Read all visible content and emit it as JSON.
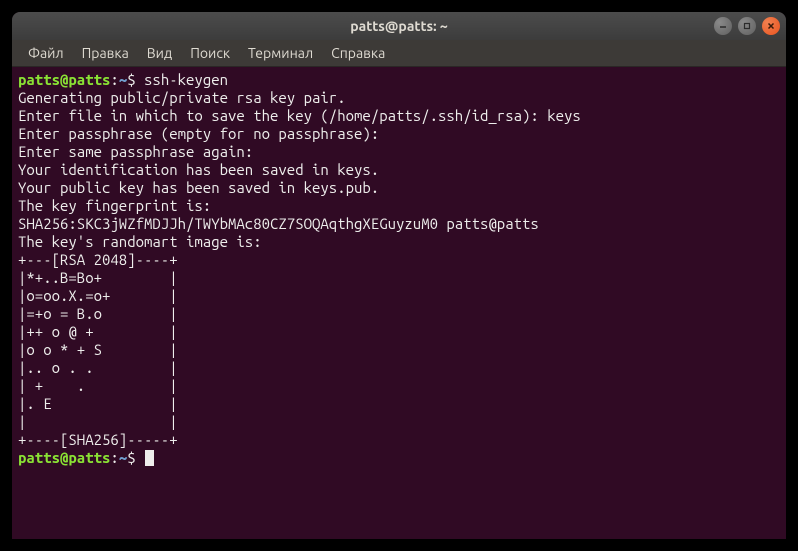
{
  "window": {
    "title": "patts@patts: ~"
  },
  "menu": {
    "items": [
      "Файл",
      "Правка",
      "Вид",
      "Поиск",
      "Терминал",
      "Справка"
    ]
  },
  "prompt": {
    "userhost": "patts@patts",
    "sep": ":",
    "path": "~",
    "symbol": "$"
  },
  "session": {
    "command1": "ssh-keygen",
    "lines": [
      "Generating public/private rsa key pair.",
      "Enter file in which to save the key (/home/patts/.ssh/id_rsa): keys",
      "Enter passphrase (empty for no passphrase):",
      "Enter same passphrase again:",
      "Your identification has been saved in keys.",
      "Your public key has been saved in keys.pub.",
      "The key fingerprint is:",
      "SHA256:SKC3jWZfMDJJh/TWYbMAc80CZ7SOQAqthgXEGuyzuM0 patts@patts",
      "The key's randomart image is:",
      "+---[RSA 2048]----+",
      "|*+..B=Bo+        |",
      "|o=oo.X.=o+       |",
      "|=+o = B.o        |",
      "|++ o @ +         |",
      "|o o * + S        |",
      "|.. o . .         |",
      "| +    .          |",
      "|. E              |",
      "|                 |",
      "+----[SHA256]-----+"
    ]
  }
}
